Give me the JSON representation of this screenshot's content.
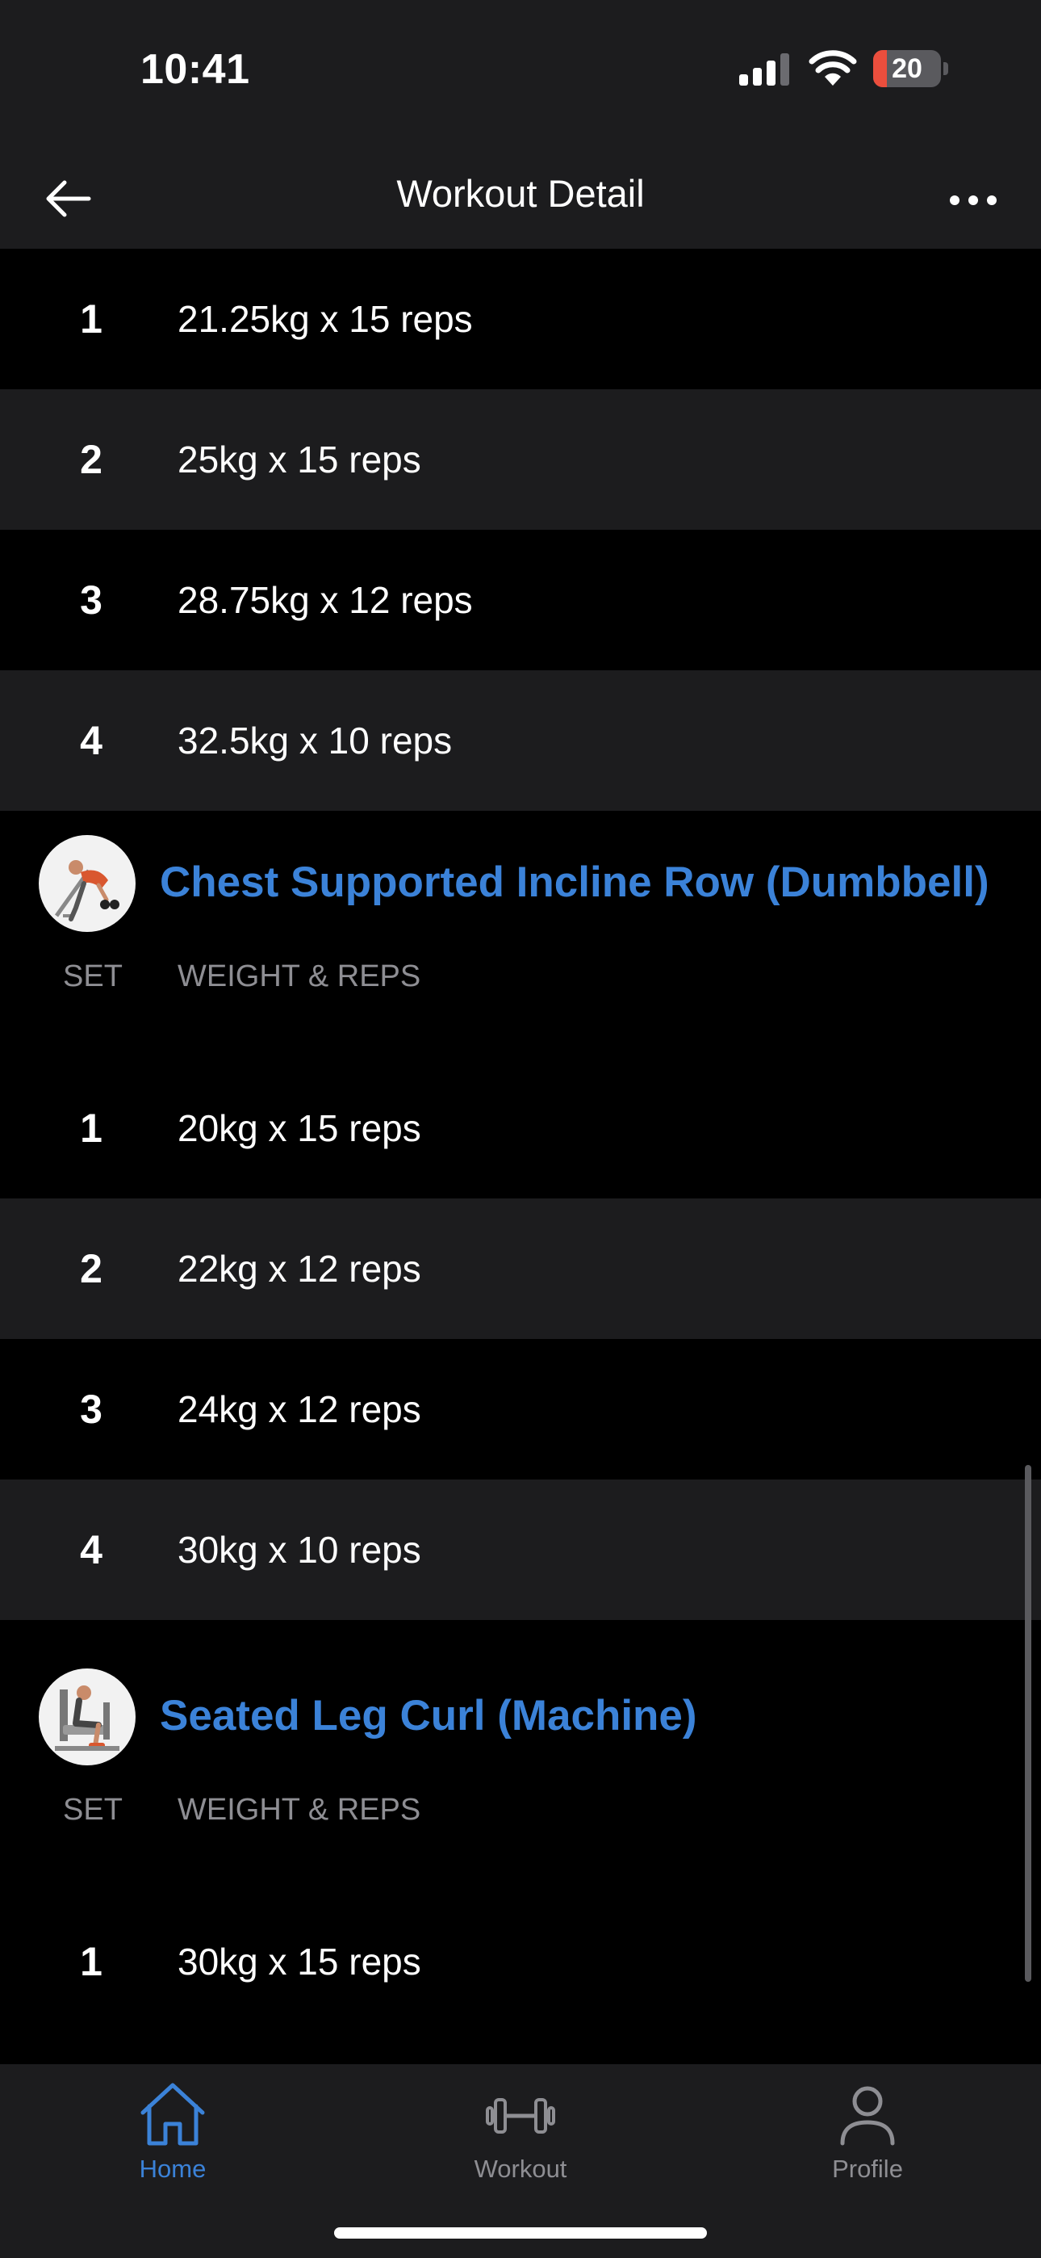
{
  "status_bar": {
    "time": "10:41",
    "battery_level": "20",
    "battery_fraction": 0.2
  },
  "nav": {
    "title": "Workout Detail"
  },
  "columns": {
    "set": "SET",
    "weight_reps": "WEIGHT & REPS"
  },
  "previous_sets": [
    {
      "num": "1",
      "value": "21.25kg x 15 reps"
    },
    {
      "num": "2",
      "value": "25kg x 15 reps"
    },
    {
      "num": "3",
      "value": "28.75kg x 12 reps"
    },
    {
      "num": "4",
      "value": "32.5kg x 10 reps"
    }
  ],
  "exercises": [
    {
      "name": "Chest Supported Incline Row (Dumbbell)",
      "sets": [
        {
          "num": "1",
          "value": "20kg x 15 reps"
        },
        {
          "num": "2",
          "value": "22kg x 12 reps"
        },
        {
          "num": "3",
          "value": "24kg x 12 reps"
        },
        {
          "num": "4",
          "value": "30kg x 10 reps"
        }
      ]
    },
    {
      "name": "Seated Leg Curl (Machine)",
      "sets": [
        {
          "num": "1",
          "value": "30kg x 15 reps"
        }
      ]
    }
  ],
  "tabs": [
    {
      "label": "Home",
      "icon": "home-icon",
      "active": true
    },
    {
      "label": "Workout",
      "icon": "dumbbell-icon",
      "active": false
    },
    {
      "label": "Profile",
      "icon": "person-icon",
      "active": false
    }
  ],
  "colors": {
    "accent": "#3b82d8",
    "background": "#000000",
    "surface": "#1c1c1e",
    "muted": "#8e8e93",
    "battery_low": "#eb4e3d"
  }
}
